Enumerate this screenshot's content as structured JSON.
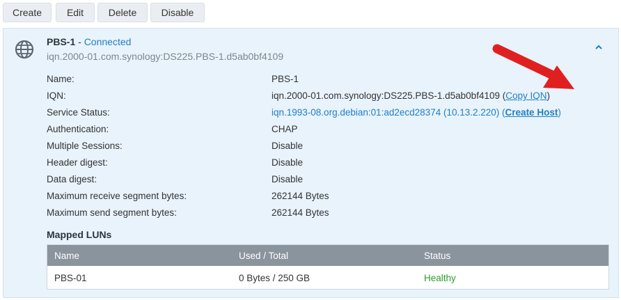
{
  "toolbar": {
    "create": "Create",
    "edit": "Edit",
    "delete": "Delete",
    "disable": "Disable"
  },
  "target": {
    "name": "PBS-1",
    "separator": " - ",
    "status": "Connected",
    "iqn_subtitle": "iqn.2000-01.com.synology:DS225.PBS-1.d5ab0bf4109",
    "icon": "globe-icon"
  },
  "properties": {
    "name_label": "Name:",
    "name_value": "PBS-1",
    "iqn_label": "IQN:",
    "iqn_value": "iqn.2000-01.com.synology:DS225.PBS-1.d5ab0bf4109",
    "copy_iqn": "Copy IQN",
    "service_status_label": "Service Status:",
    "service_status_value": "iqn.1993-08.org.debian:01:ad2ecd28374 (10.13.2.220)",
    "create_host": "Create Host",
    "authentication_label": "Authentication:",
    "authentication_value": "CHAP",
    "multiple_sessions_label": "Multiple Sessions:",
    "multiple_sessions_value": "Disable",
    "header_digest_label": "Header digest:",
    "header_digest_value": "Disable",
    "data_digest_label": "Data digest:",
    "data_digest_value": "Disable",
    "max_receive_label": "Maximum receive segment bytes:",
    "max_receive_value": "262144 Bytes",
    "max_send_label": "Maximum send segment bytes:",
    "max_send_value": "262144 Bytes"
  },
  "mapped_luns": {
    "title": "Mapped LUNs",
    "columns": [
      "Name",
      "Used / Total",
      "Status"
    ],
    "rows": [
      {
        "name": "PBS-01",
        "used_total": "0 Bytes / 250 GB",
        "status": "Healthy"
      }
    ]
  },
  "colors": {
    "accent": "#1f7fc3",
    "panel_bg": "#e8f3fc",
    "healthy": "#2c9b2c",
    "arrow": "#e02020"
  }
}
